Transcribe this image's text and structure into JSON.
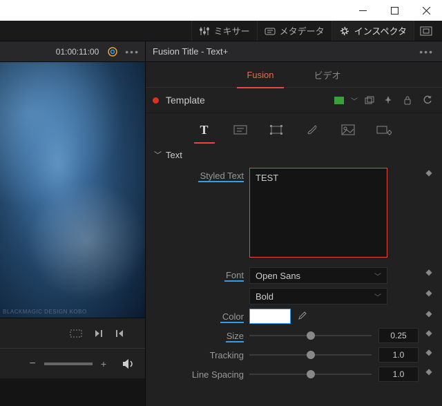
{
  "window": {
    "minimize": "−",
    "maximize": "□",
    "close": "✕"
  },
  "toolbar": {
    "mixer": "ミキサー",
    "metadata": "メタデータ",
    "inspector": "インスペクタ"
  },
  "viewer": {
    "timecode": "01:00:11:00",
    "watermark": "BLACKMAGIC DESIGN KOBO"
  },
  "panel": {
    "title": "Fusion Title - Text+",
    "tabs": {
      "fusion": "Fusion",
      "video": "ビデオ"
    }
  },
  "template": {
    "label": "Template"
  },
  "section": {
    "text": "Text"
  },
  "props": {
    "styled_text": {
      "label": "Styled Text",
      "value": "TEST"
    },
    "font": {
      "label": "Font",
      "value": "Open Sans",
      "weight": "Bold"
    },
    "color": {
      "label": "Color",
      "value": "#ffffff"
    },
    "size": {
      "label": "Size",
      "value": "0.25"
    },
    "tracking": {
      "label": "Tracking",
      "value": "1.0"
    },
    "line_spacing": {
      "label": "Line Spacing",
      "value": "1.0"
    }
  }
}
